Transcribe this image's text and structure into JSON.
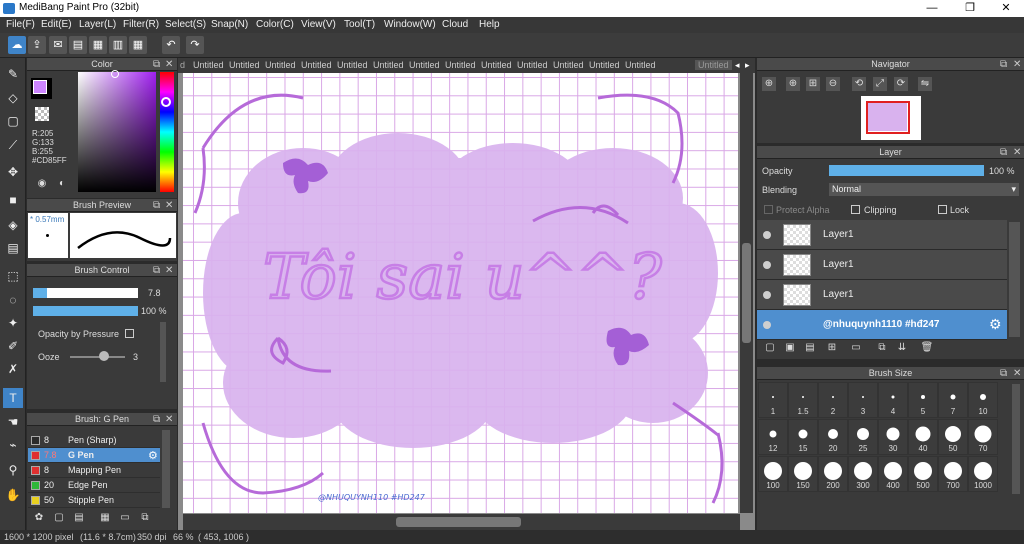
{
  "window": {
    "title": "MediBang Paint Pro (32bit)",
    "minimize": "—",
    "restore": "❐",
    "close": "✕"
  },
  "menu": [
    "File(F)",
    "Edit(E)",
    "Layer(L)",
    "Filter(R)",
    "Select(S)",
    "Snap(N)",
    "Color(C)",
    "View(V)",
    "Tool(T)",
    "Window(W)",
    "Cloud",
    "Help"
  ],
  "tabs": [
    "Untitled",
    "Untitled",
    "Untitled",
    "Untitled",
    "Untitled",
    "Untitled",
    "Untitled",
    "Untitled",
    "Untitled",
    "Untitled",
    "Untitled",
    "Untitled",
    "Untitled",
    "Untitled"
  ],
  "color_panel": {
    "title": "Color",
    "r": "R:205",
    "g": "G:133",
    "b": "B:255",
    "hex": "#CD85FF",
    "current_color": "#CD85FF"
  },
  "brush_preview": {
    "title": "Brush Preview",
    "size": "* 0.57mm"
  },
  "brush_control": {
    "title": "Brush Control",
    "size_value": "7.8",
    "opacity_value": "100 %",
    "opacity_by_pressure": "Opacity by Pressure",
    "ooze_label": "Ooze",
    "ooze_value": "3"
  },
  "brush_list": {
    "title": "Brush: G Pen",
    "items": [
      {
        "size": "8",
        "name": "Pen (Sharp)",
        "color": "#2b2b2b"
      },
      {
        "size": "7.8",
        "name": "G Pen",
        "color": "#e03030"
      },
      {
        "size": "8",
        "name": "Mapping Pen",
        "color": "#e03030"
      },
      {
        "size": "20",
        "name": "Edge Pen",
        "color": "#2fb83a"
      },
      {
        "size": "50",
        "name": "Stipple Pen",
        "color": "#e8d020"
      }
    ]
  },
  "canvas": {
    "main_text": "Tôi sai u^^?",
    "signature": "@NHUQUYNH110 #HD247"
  },
  "navigator": {
    "title": "Navigator"
  },
  "layer_panel": {
    "title": "Layer",
    "opacity_label": "Opacity",
    "opacity_value": "100 %",
    "opacity_fraction": 1.0,
    "blending_label": "Blending",
    "blending_value": "Normal",
    "protect_alpha": "Protect Alpha",
    "clipping": "Clipping",
    "lock": "Lock",
    "layers": [
      "Layer1",
      "Layer1",
      "Layer1",
      "@nhuquynh1110 #hđ247"
    ]
  },
  "brush_size": {
    "title": "Brush Size",
    "sizes": [
      "1",
      "1.5",
      "2",
      "3",
      "4",
      "5",
      "7",
      "10",
      "12",
      "15",
      "20",
      "25",
      "30",
      "40",
      "50",
      "70",
      "100",
      "150",
      "200",
      "300",
      "400",
      "500",
      "700",
      "1000"
    ]
  },
  "status": {
    "dimensions": "1600 * 1200 pixel",
    "physical": "(11.6 * 8.7cm)",
    "dpi": "350 dpi",
    "zoom": "66 %",
    "coords": "( 453, 1006 )"
  }
}
